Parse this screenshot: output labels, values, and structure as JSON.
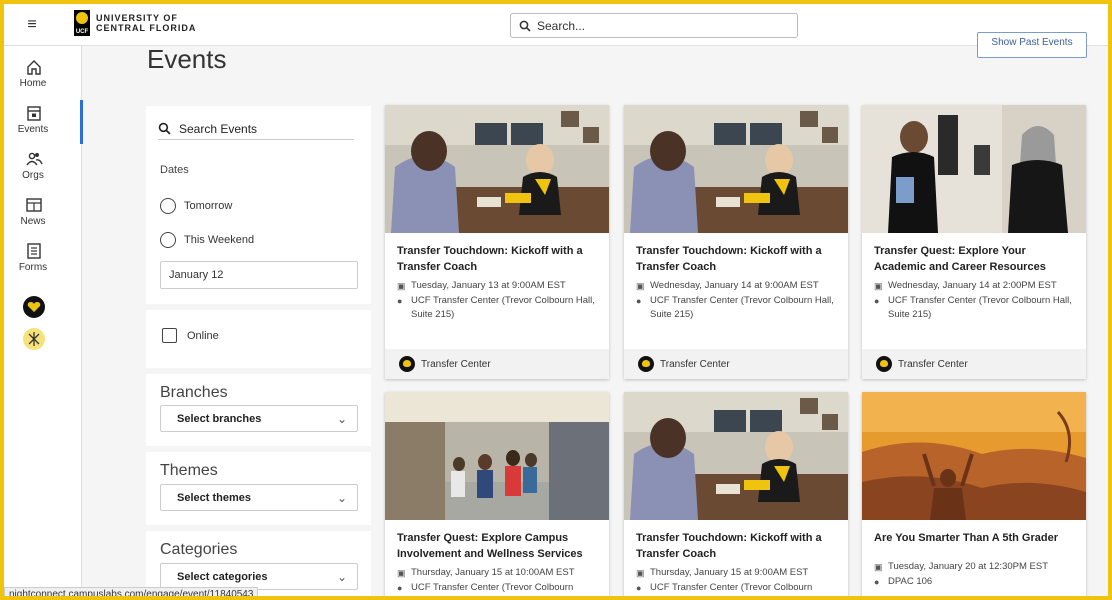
{
  "app": {
    "logo_line1": "UNIVERSITY OF",
    "logo_line2": "CENTRAL FLORIDA",
    "logo_badge": "UCF",
    "search_placeholder": "Search..."
  },
  "rail": {
    "items": [
      {
        "label": "Home",
        "icon": "home-icon"
      },
      {
        "label": "Events",
        "icon": "calendar-icon",
        "active": true
      },
      {
        "label": "Orgs",
        "icon": "people-icon"
      },
      {
        "label": "News",
        "icon": "newspaper-icon"
      },
      {
        "label": "Forms",
        "icon": "form-icon"
      }
    ]
  },
  "page": {
    "title": "Events",
    "past_events_button": "Show Past Events"
  },
  "filters": {
    "search_placeholder": "Search Events",
    "dates_label": "Dates",
    "tomorrow": "Tomorrow",
    "this_weekend": "This Weekend",
    "date_value": "January 12",
    "online": "Online",
    "branches_title": "Branches",
    "branches_select": "Select branches",
    "themes_title": "Themes",
    "themes_select": "Select themes",
    "categories_title": "Categories",
    "categories_select": "Select categories"
  },
  "events": [
    {
      "title": "Transfer Touchdown: Kickoff with a Transfer Coach",
      "date": "Tuesday, January 13 at 9:00AM EST",
      "location": "UCF Transfer Center (Trevor Colbourn Hall, Suite 215)",
      "org": "Transfer Center",
      "image": "office-meeting"
    },
    {
      "title": "Transfer Touchdown: Kickoff with a Transfer Coach",
      "date": "Wednesday, January 14 at 9:00AM EST",
      "location": "UCF Transfer Center (Trevor Colbourn Hall, Suite 215)",
      "org": "Transfer Center",
      "image": "office-meeting"
    },
    {
      "title": "Transfer Quest: Explore Your Academic and Career Resources",
      "date": "Wednesday, January 14 at 2:00PM EST",
      "location": "UCF Transfer Center (Trevor Colbourn Hall, Suite 215)",
      "org": "Transfer Center",
      "image": "two-people-talking"
    },
    {
      "title": "Transfer Quest: Explore Campus Involvement and Wellness Services",
      "date": "Thursday, January 15 at 10:00AM EST",
      "location": "UCF Transfer Center (Trevor Colbourn",
      "image": "campus-walk"
    },
    {
      "title": "Transfer Touchdown: Kickoff with a Transfer Coach",
      "date": "Thursday, January 15 at 9:00AM EST",
      "location": "UCF Transfer Center (Trevor Colbourn",
      "image": "office-meeting"
    },
    {
      "title": "Are You Smarter Than A 5th Grader",
      "date": "Tuesday, January 20 at 12:30PM EST",
      "location": "DPAC 106",
      "image": "orange-canyon"
    }
  ],
  "status_bar": "nightconnect.campuslabs.com/engage/event/11840543",
  "colors": {
    "brand_gold": "#f0c30e",
    "active_blue": "#2a6fdb"
  }
}
